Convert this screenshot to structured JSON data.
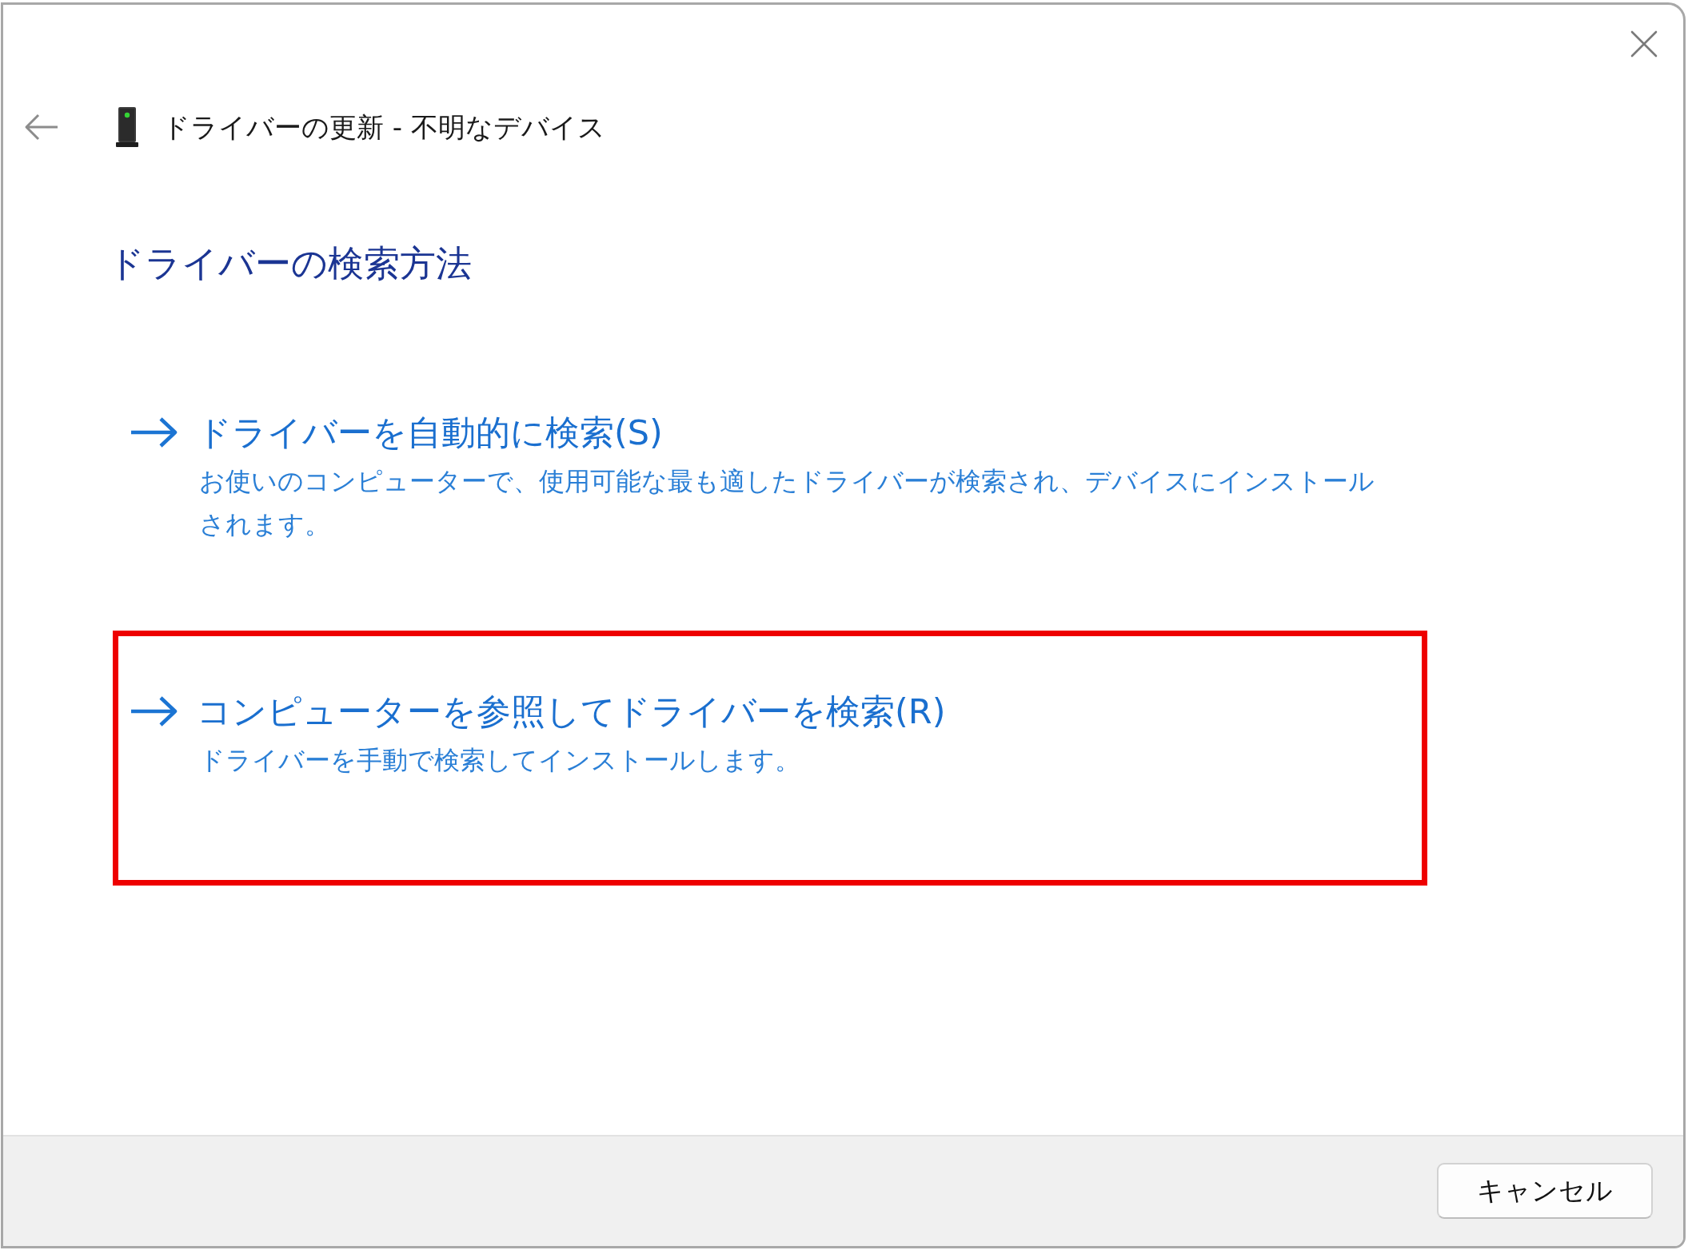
{
  "window": {
    "title": "ドライバーの更新 - 不明なデバイス"
  },
  "main_instruction": "ドライバーの検索方法",
  "options": [
    {
      "title": "ドライバーを自動的に検索(S)",
      "description": "お使いのコンピューターで、使用可能な最も適したドライバーが検索され、デバイスにインストールされます。",
      "highlighted": false
    },
    {
      "title": "コンピューターを参照してドライバーを検索(R)",
      "description": "ドライバーを手動で検索してインストールします。",
      "highlighted": true
    }
  ],
  "buttons": [
    "キャンセル"
  ]
}
